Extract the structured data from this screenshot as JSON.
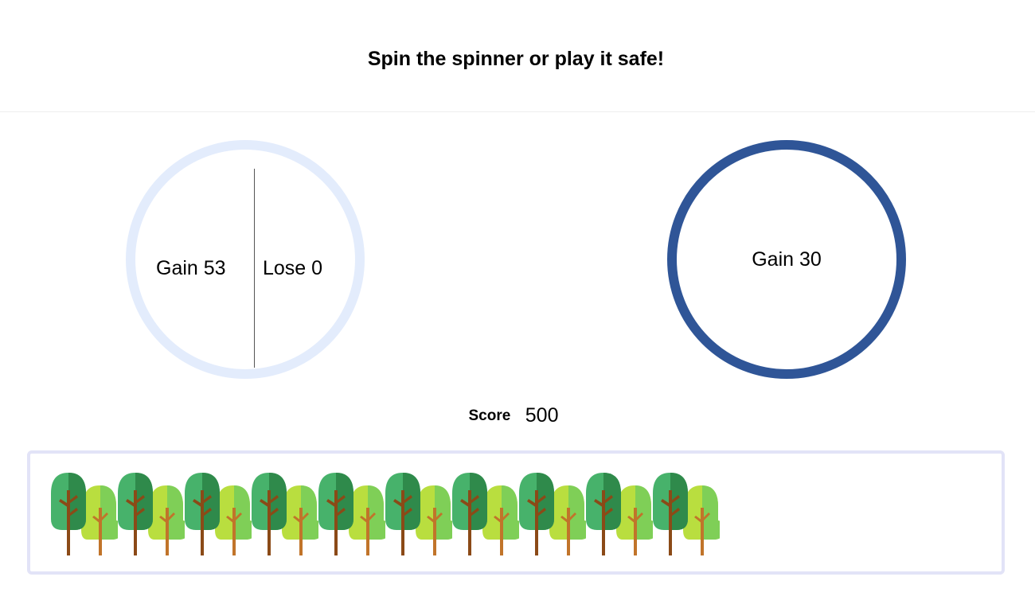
{
  "header": {
    "title": "Spin the spinner or play it safe!"
  },
  "spinner": {
    "left_label": "Gain 53",
    "right_label": "Lose 0",
    "ring_color": "#e3ecfc"
  },
  "safe_option": {
    "label": "Gain 30",
    "ring_color": "#2f5597"
  },
  "score": {
    "label": "Score",
    "value": "500"
  },
  "forest": {
    "tree_pairs": 10,
    "icon": "tree-icon"
  }
}
